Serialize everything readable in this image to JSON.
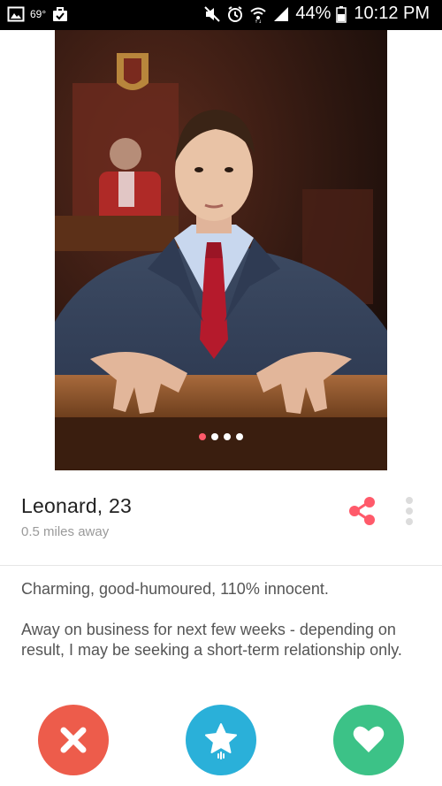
{
  "status_bar": {
    "temperature": "69°",
    "battery_percent": "44%",
    "time": "10:12 PM"
  },
  "profile": {
    "name_age": "Leonard, 23",
    "distance": "0.5 miles away",
    "bio": [
      "Charming, good-humoured, 110% innocent.",
      "Away on business for next few weeks - depending on result, I may be seeking a short-term relationship only."
    ],
    "photo_count": 4,
    "current_photo": 1
  },
  "icons": {
    "share": "share-icon",
    "more": "more-vert-icon",
    "nope": "close-icon",
    "super_like": "star-icon",
    "like": "heart-icon"
  },
  "colors": {
    "accent": "#ff5a6a",
    "nope": "#ed5c4b",
    "super_like": "#2ab0d9",
    "like": "#3cc287"
  }
}
